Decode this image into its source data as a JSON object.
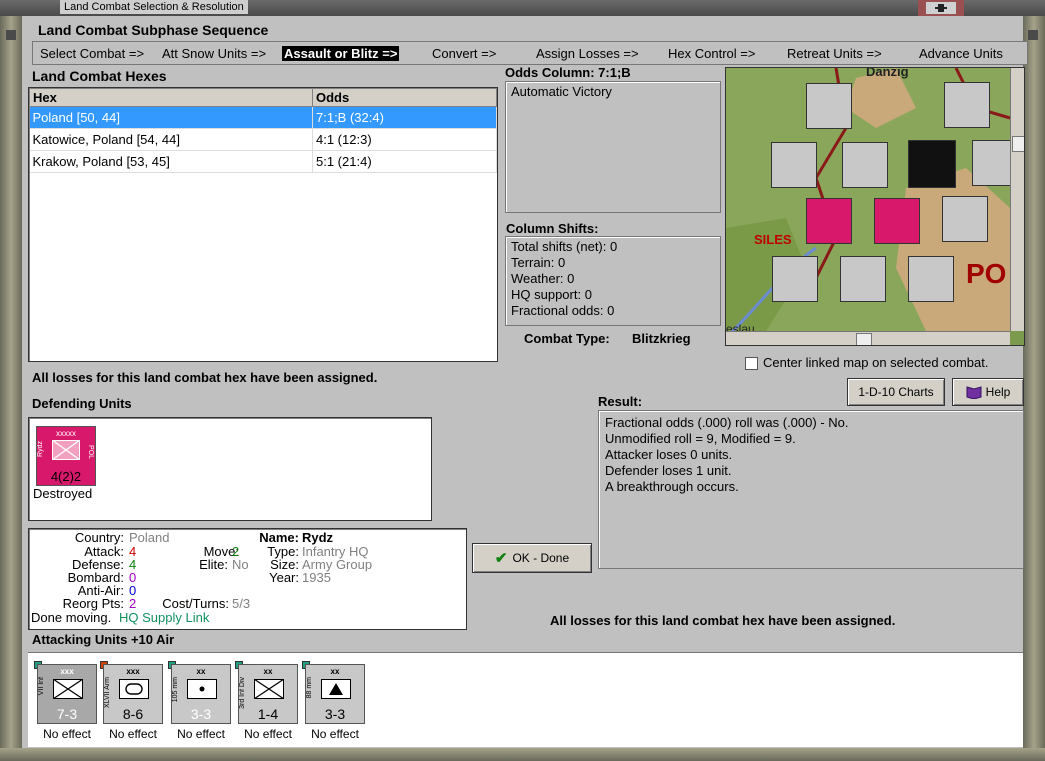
{
  "window": {
    "title": "Land Combat Selection & Resolution"
  },
  "subphase": {
    "title": "Land Combat Subphase Sequence",
    "steps": [
      "Select Combat =>",
      "Att Snow Units =>",
      "Assault or Blitz =>",
      "Convert =>",
      "Assign Losses =>",
      "Hex Control =>",
      "Retreat Units =>",
      "Advance Units"
    ],
    "active_index": 2
  },
  "hexes": {
    "title": "Land Combat Hexes",
    "columns": [
      "Hex",
      "Odds"
    ],
    "rows": [
      [
        "Poland [50, 44]",
        "7:1;B (32:4)"
      ],
      [
        "Katowice, Poland [54, 44]",
        "4:1 (12:3)"
      ],
      [
        "Krakow, Poland [53, 45]",
        "5:1 (21:4)"
      ]
    ],
    "selected_row": 0
  },
  "odds": {
    "title": "Odds Column: 7:1;B",
    "text": "Automatic Victory"
  },
  "shifts": {
    "title": "Column Shifts:",
    "lines": [
      "Total shifts (net): 0",
      "Terrain: 0",
      "Weather: 0",
      "HQ support: 0",
      "Fractional odds: 0"
    ]
  },
  "combat_type": {
    "label": "Combat Type:",
    "value": "Blitzkrieg"
  },
  "map": {
    "labels": [
      "Danzig",
      "SILES",
      "PO",
      "eslau"
    ],
    "center_checkbox": "Center linked map on selected combat."
  },
  "losses_message": "All losses for this land combat hex have been assigned.",
  "buttons": {
    "charts": "1-D-10 Charts",
    "help": "Help",
    "ok": "OK - Done"
  },
  "defending": {
    "title": "Defending Units",
    "unit": {
      "size": "xxxxx",
      "side_label": "Rydz",
      "nation": "POL",
      "value": "4(2)2",
      "status": "Destroyed",
      "color": "#d8186a"
    }
  },
  "details": {
    "country_label": "Country:",
    "country": "Poland",
    "attack_label": "Attack:",
    "attack": "4",
    "defense_label": "Defense:",
    "defense": "4",
    "bombard_label": "Bombard:",
    "bombard": "0",
    "antiair_label": "Anti-Air:",
    "antiair": "0",
    "reorg_label": "Reorg Pts:",
    "reorg": "2",
    "move_label": "Move:",
    "move": "2",
    "elite_label": "Elite:",
    "elite": "No",
    "cost_label": "Cost/Turns:",
    "cost": "5/3",
    "name_label": "Name:",
    "name": "Rydz",
    "type_label": "Type:",
    "type": "Infantry HQ",
    "size_label": "Size:",
    "size": "Army Group",
    "year_label": "Year:",
    "year": "1935",
    "done_moving": "Done moving.",
    "supply": "HQ Supply Link"
  },
  "result": {
    "title": "Result:",
    "lines": [
      "Fractional odds (.000) roll was (.000)  - No.",
      "Unmodified roll = 9, Modified = 9.",
      "Attacker loses 0 units.",
      "Defender loses 1 unit.",
      "A breakthrough occurs."
    ]
  },
  "attacking": {
    "title": "Attacking Units +10 Air",
    "units": [
      {
        "size": "xxx",
        "side_label": "VII Inf",
        "value": "7-3",
        "symbol": "infantry",
        "status": "No effect"
      },
      {
        "size": "xxx",
        "side_label": "XLVII Arm",
        "value": "8-6",
        "symbol": "armor",
        "status": "No effect"
      },
      {
        "size": "xx",
        "side_label": "105 mm",
        "value": "3-3",
        "symbol": "artillery",
        "status": "No effect"
      },
      {
        "size": "xx",
        "side_label": "3rd Inf Div",
        "value": "1-4",
        "symbol": "infantry",
        "status": "No effect"
      },
      {
        "size": "xx",
        "side_label": "88 mm",
        "value": "3-3",
        "symbol": "antiair",
        "status": "No effect"
      }
    ]
  }
}
